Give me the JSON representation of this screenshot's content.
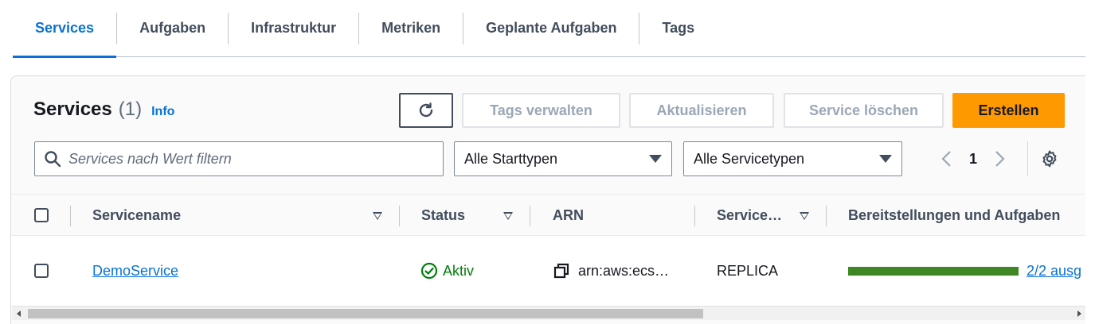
{
  "tabs": [
    {
      "label": "Services",
      "active": true
    },
    {
      "label": "Aufgaben"
    },
    {
      "label": "Infrastruktur"
    },
    {
      "label": "Metriken"
    },
    {
      "label": "Geplante Aufgaben"
    },
    {
      "label": "Tags"
    }
  ],
  "panel": {
    "title": "Services",
    "count": "(1)",
    "info": "Info"
  },
  "buttons": {
    "manage_tags": "Tags verwalten",
    "update": "Aktualisieren",
    "delete": "Service löschen",
    "create": "Erstellen"
  },
  "filters": {
    "search_placeholder": "Services nach Wert filtern",
    "launch_type": "Alle Starttypen",
    "service_type": "Alle Servicetypen"
  },
  "pagination": {
    "current_page": "1"
  },
  "table": {
    "headers": {
      "name": "Servicename",
      "status": "Status",
      "arn": "ARN",
      "service_type": "Service…",
      "deployments": "Bereitstellungen und Aufgaben"
    },
    "rows": [
      {
        "name": "DemoService",
        "status": "Aktiv",
        "arn": "arn:aws:ecs…",
        "service_type": "REPLICA",
        "deployments": "2/2 ausg",
        "deployments_progress": 1.0
      }
    ]
  },
  "colors": {
    "accent": "#0972d3",
    "primary_button": "#ff9900",
    "success": "#037f0c",
    "progress": "#3f8624"
  },
  "icons": [
    "refresh-icon",
    "search-icon",
    "chevron-down-icon",
    "chevron-left-icon",
    "chevron-right-icon",
    "gear-icon",
    "sort-icon",
    "status-ok-icon",
    "copy-icon"
  ]
}
